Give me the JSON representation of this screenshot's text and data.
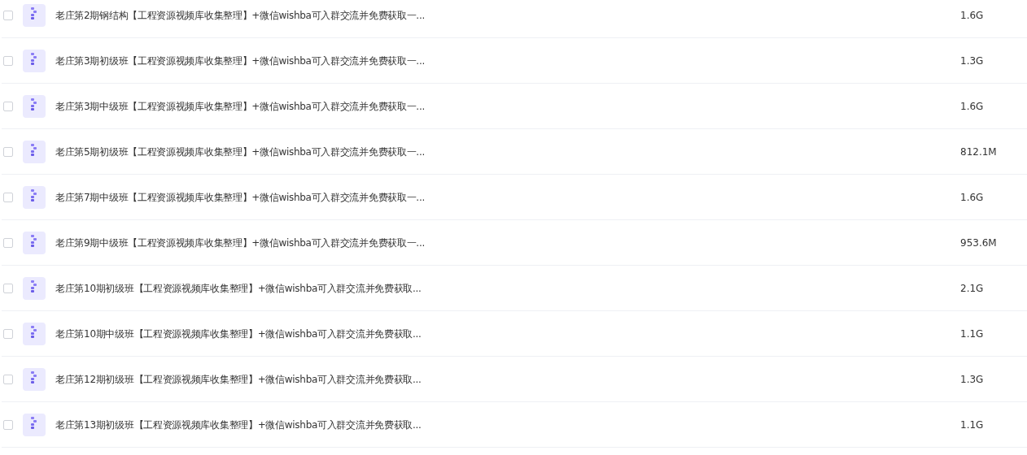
{
  "files": [
    {
      "name": "老庄第2期钢结构【工程资源视频库收集整理】+微信wishba可入群交流并免费获取一...",
      "size": "1.6G",
      "checked": false
    },
    {
      "name": "老庄第3期初级班【工程资源视频库收集整理】+微信wishba可入群交流并免费获取一...",
      "size": "1.3G",
      "checked": false
    },
    {
      "name": "老庄第3期中级班【工程资源视频库收集整理】+微信wishba可入群交流并免费获取一...",
      "size": "1.6G",
      "checked": false
    },
    {
      "name": "老庄第5期初级班【工程资源视频库收集整理】+微信wishba可入群交流并免费获取一...",
      "size": "812.1M",
      "checked": false
    },
    {
      "name": "老庄第7期中级班【工程资源视频库收集整理】+微信wishba可入群交流并免费获取一...",
      "size": "1.6G",
      "checked": false
    },
    {
      "name": "老庄第9期中级班【工程资源视频库收集整理】+微信wishba可入群交流并免费获取一...",
      "size": "953.6M",
      "checked": false
    },
    {
      "name": "老庄第10期初级班【工程资源视频库收集整理】+微信wishba可入群交流并免费获取...",
      "size": "2.1G",
      "checked": false
    },
    {
      "name": "老庄第10期中级班【工程资源视频库收集整理】+微信wishba可入群交流并免费获取...",
      "size": "1.1G",
      "checked": false
    },
    {
      "name": "老庄第12期初级班【工程资源视频库收集整理】+微信wishba可入群交流并免费获取...",
      "size": "1.3G",
      "checked": false
    },
    {
      "name": "老庄第13期初级班【工程资源视频库收集整理】+微信wishba可入群交流并免费获取...",
      "size": "1.1G",
      "checked": false
    }
  ]
}
